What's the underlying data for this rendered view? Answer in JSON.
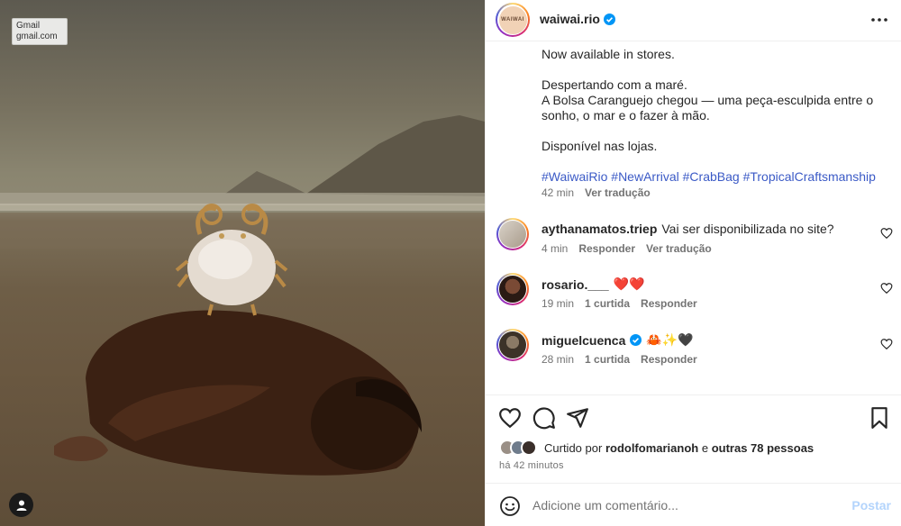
{
  "colors": {
    "accent": "#0095f6",
    "link": "#3b5ac6",
    "muted": "#737373",
    "text": "#262626",
    "heart_red": "#ed4956"
  },
  "overlay": {
    "gmail_title": "Gmail",
    "gmail_sub": "gmail.com"
  },
  "post": {
    "username": "waiwai.rio",
    "brand_mark": "WAIWAI",
    "verified": true,
    "caption_lines": [
      "Now available in stores.",
      "Despertando com a maré.",
      "A Bolsa Caranguejo chegou — uma peça-esculpida entre o",
      "sonho, o mar e o fazer à mão.",
      "Disponível nas lojas."
    ],
    "hashtags": [
      "#WaiwaiRio",
      "#NewArrival",
      "#CrabBag",
      "#TropicalCraftsmanship"
    ],
    "caption_time": "42 min",
    "see_translation": "Ver tradução"
  },
  "comments": [
    {
      "username": "aythanamatos.triep",
      "text": "Vai ser disponibilizada no site?",
      "time": "4 min",
      "reply": "Responder",
      "translate": "Ver tradução"
    },
    {
      "username": "rosario.___",
      "text": "❤️❤️",
      "time": "19 min",
      "likes": "1 curtida",
      "reply": "Responder"
    },
    {
      "username": "miguelcuenca",
      "verified": true,
      "text": "🦀✨🖤",
      "time": "28 min",
      "likes": "1 curtida",
      "reply": "Responder"
    }
  ],
  "actions": {
    "icons": [
      "heart-icon",
      "comment-icon",
      "share-icon",
      "bookmark-icon"
    ],
    "liked_by_prefix": "Curtido por",
    "liked_by_user": "rodolfomarianoh",
    "liked_by_suffix_pre": "e",
    "liked_by_others": "outras 78 pessoas",
    "time_ago": "há 42 minutos"
  },
  "add_comment": {
    "placeholder": "Adicione um comentário...",
    "post_label": "Postar"
  }
}
